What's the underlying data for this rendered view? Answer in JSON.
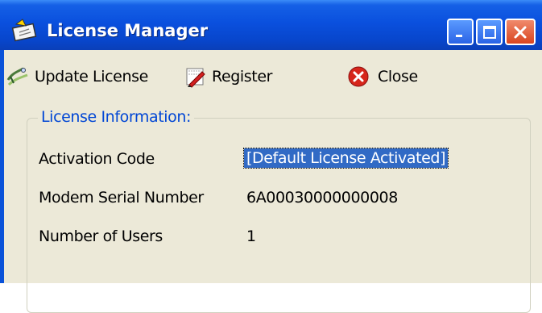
{
  "window": {
    "title": "License Manager"
  },
  "toolbar": {
    "update_label": "Update License",
    "register_label": "Register",
    "close_label": "Close"
  },
  "license_info": {
    "group_title": "License Information:",
    "activation_code_label": "Activation Code",
    "activation_code_value": "[Default License Activated]",
    "serial_label": "Modem Serial Number",
    "serial_value": "6A00030000000008",
    "users_label": "Number of Users",
    "users_value": "1"
  },
  "colors": {
    "titlebar": "#0a50de",
    "client_bg": "#ece9d8",
    "group_title": "#0046d5",
    "selection": "#316ac5"
  }
}
